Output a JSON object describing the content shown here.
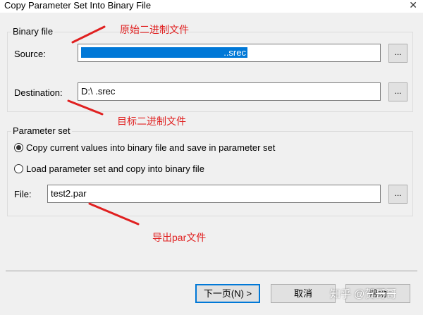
{
  "window": {
    "title": "Copy Parameter Set Into Binary File"
  },
  "binary_file": {
    "legend": "Binary file",
    "source_label": "Source:",
    "source_value": "..srec",
    "destination_label": "Destination:",
    "destination_value": "D:\\ .srec"
  },
  "parameter_set": {
    "legend": "Parameter set",
    "option1": "Copy current values into binary file and save in parameter set",
    "option2": "Load parameter set and copy into binary file",
    "file_label": "File:",
    "file_value": "test2.par"
  },
  "browse_label": "...",
  "annotations": {
    "source": "原始二进制文件",
    "destination": "目标二进制文件",
    "export": "导出par文件"
  },
  "buttons": {
    "next": "下一页(N) >",
    "cancel": "取消",
    "help": "帮助"
  },
  "watermark": "知乎 @贺哥哥",
  "colors": {
    "annotation": "#e02020",
    "selection": "#0078d7"
  }
}
